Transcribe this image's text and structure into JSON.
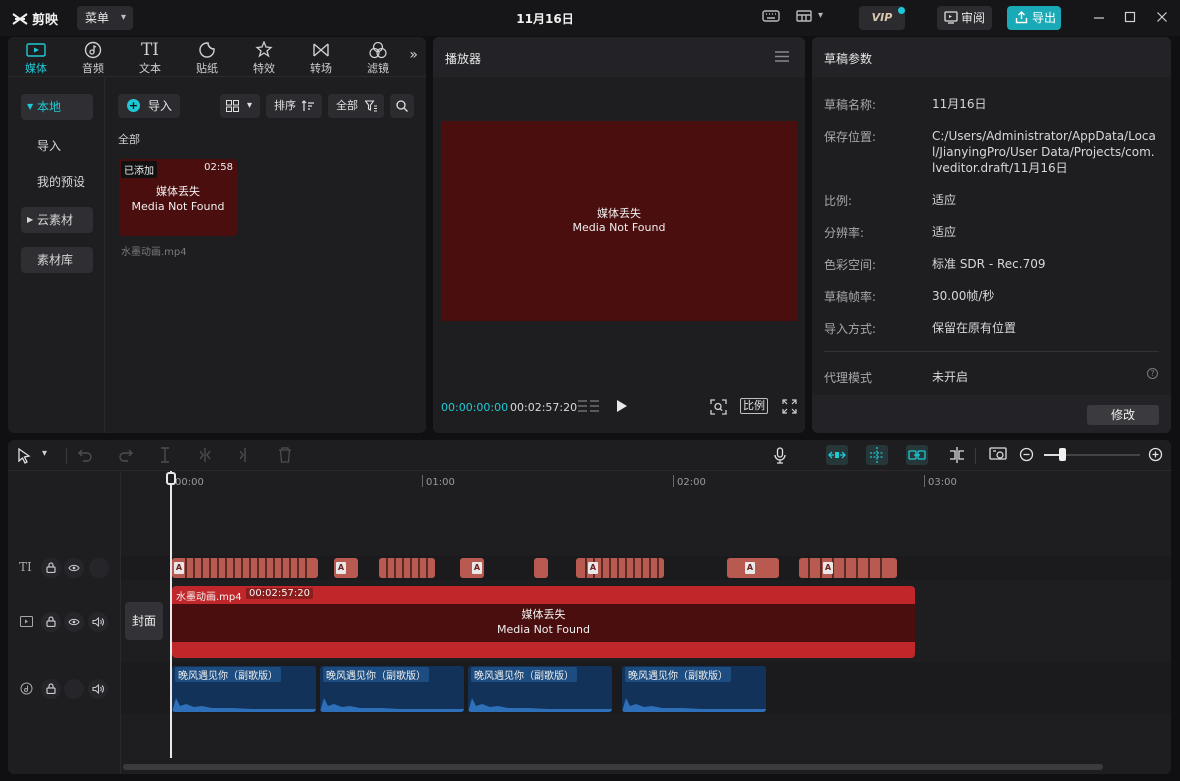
{
  "app": {
    "brand": "剪映",
    "menu_label": "菜单",
    "window_title": "11月16日",
    "vip_label": "VIP",
    "review_label": "审阅",
    "export_label": "导出"
  },
  "media_panel": {
    "tabs": [
      {
        "label": "媒体",
        "icon": "media-icon",
        "active": true
      },
      {
        "label": "音频",
        "icon": "audio-icon",
        "active": false
      },
      {
        "label": "文本",
        "icon": "text-icon",
        "active": false
      },
      {
        "label": "贴纸",
        "icon": "sticker-icon",
        "active": false
      },
      {
        "label": "特效",
        "icon": "effects-icon",
        "active": false
      },
      {
        "label": "转场",
        "icon": "transition-icon",
        "active": false
      },
      {
        "label": "滤镜",
        "icon": "filter-icon",
        "active": false
      }
    ],
    "nav": [
      {
        "label": "本地",
        "active": true
      },
      {
        "label": "导入"
      },
      {
        "label": "我的预设"
      },
      {
        "label": "云素材"
      },
      {
        "label": "素材库"
      }
    ],
    "import_label": "导入",
    "sort_label": "排序",
    "filter_label": "全部",
    "section_label": "全部",
    "item": {
      "badge": "已添加",
      "duration": "02:58",
      "missing_cn": "媒体丢失",
      "missing_en": "Media Not Found",
      "filename": "水墨动画.mp4"
    }
  },
  "player": {
    "title": "播放器",
    "missing_cn": "媒体丢失",
    "missing_en": "Media Not Found",
    "current_time": "00:00:00:00",
    "total_time": "00:02:57:20",
    "ratio_label": "比例"
  },
  "draft": {
    "title": "草稿参数",
    "rows": [
      {
        "key": "草稿名称:",
        "value": "11月16日"
      },
      {
        "key": "保存位置:",
        "value": "C:/Users/Administrator/AppData/Local/JianyingPro/User Data/Projects/com.lveditor.draft/11月16日"
      },
      {
        "key": "比例:",
        "value": "适应"
      },
      {
        "key": "分辨率:",
        "value": "适应"
      },
      {
        "key": "色彩空间:",
        "value": "标准 SDR - Rec.709"
      },
      {
        "key": "草稿帧率:",
        "value": "30.00帧/秒"
      },
      {
        "key": "导入方式:",
        "value": "保留在原有位置"
      }
    ],
    "proxy_key": "代理模式",
    "proxy_value": "未开启",
    "modify_label": "修改"
  },
  "timeline": {
    "ruler": [
      "00:00",
      "01:00",
      "02:00",
      "03:00"
    ],
    "cover_label": "封面",
    "video_clip": {
      "name": "水墨动画.mp4",
      "duration": "00:02:57:20",
      "missing_cn": "媒体丢失",
      "missing_en": "Media Not Found"
    },
    "audio_clips": [
      {
        "label": "晚风遇见你（副歌版）"
      },
      {
        "label": "晚风遇见你（副歌版）"
      },
      {
        "label": "晚风遇见你（副歌版）"
      },
      {
        "label": "晚风遇见你（副歌版）"
      }
    ],
    "zoom_level": 0.18
  },
  "colors": {
    "accent": "#1fc9d4",
    "export": "#1aa9b6",
    "missing_media": "#4a0e0e",
    "video_clip": "#c0272a",
    "audio_clip": "#13325a",
    "text_clip": "#b85a50"
  }
}
